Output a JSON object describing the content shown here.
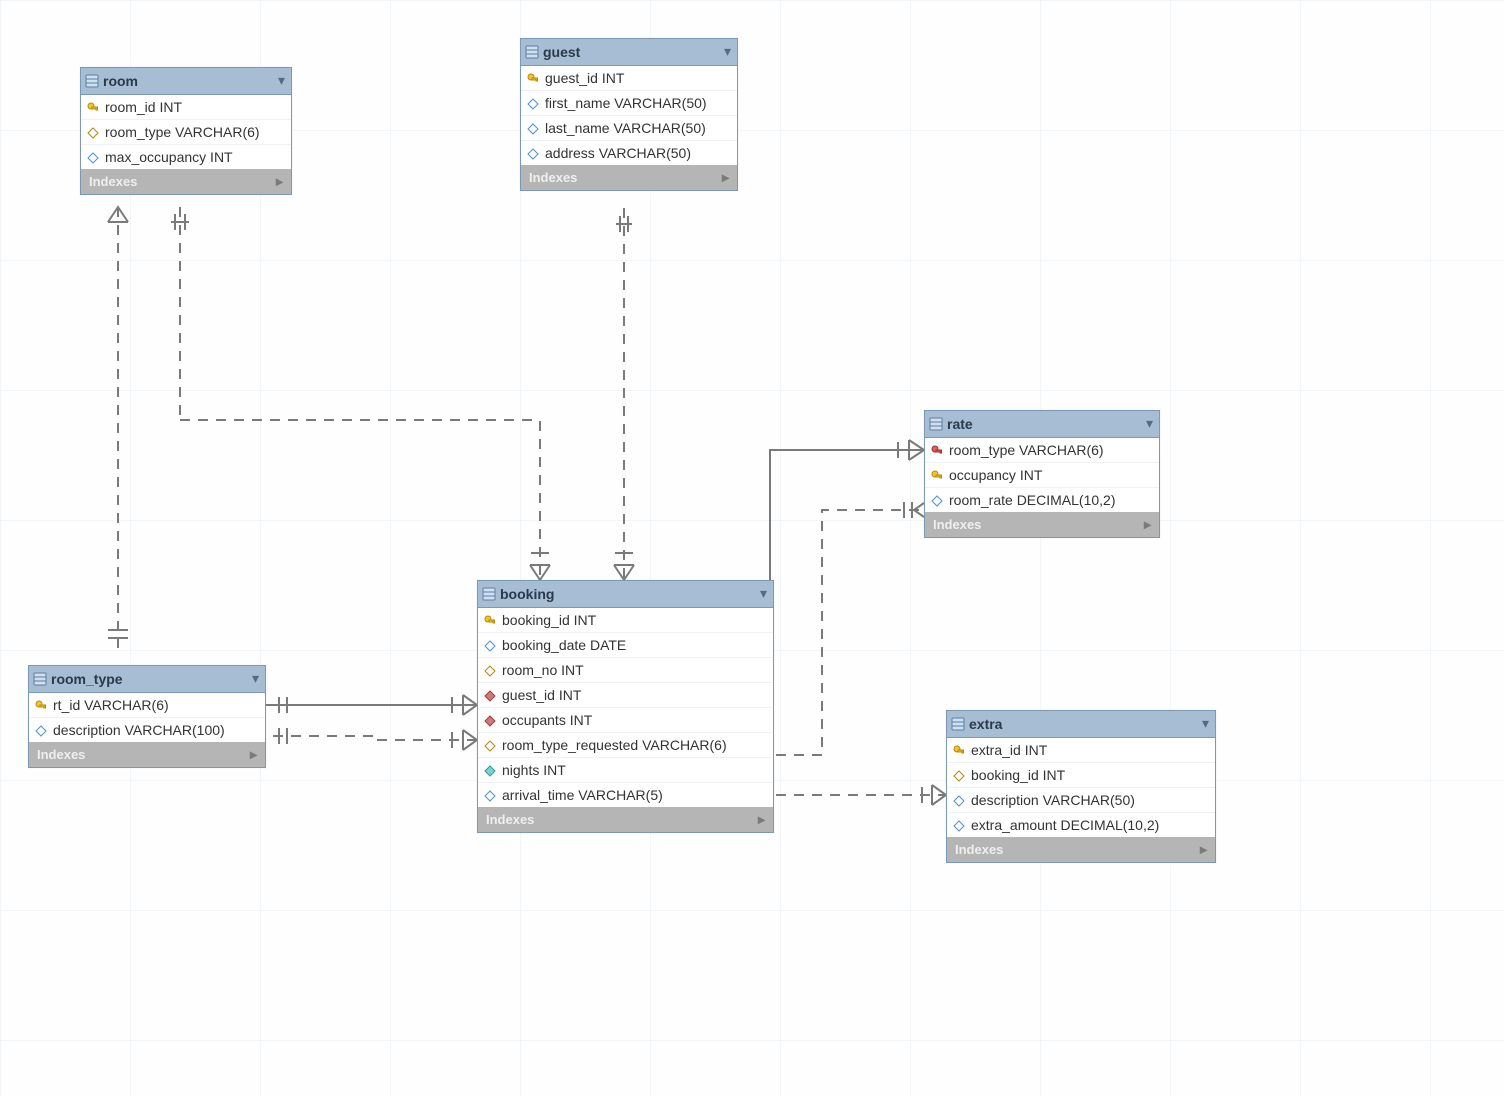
{
  "diagram": {
    "indexes_label": "Indexes",
    "tables": {
      "room": {
        "title": "room",
        "columns": [
          {
            "name": "room_id",
            "type": "INT",
            "icon": "pk"
          },
          {
            "name": "room_type",
            "type": "VARCHAR(6)",
            "icon": "diamond-open"
          },
          {
            "name": "max_occupancy",
            "type": "INT",
            "icon": "diamond-blue"
          }
        ]
      },
      "guest": {
        "title": "guest",
        "columns": [
          {
            "name": "guest_id",
            "type": "INT",
            "icon": "pk"
          },
          {
            "name": "first_name",
            "type": "VARCHAR(50)",
            "icon": "diamond-blue"
          },
          {
            "name": "last_name",
            "type": "VARCHAR(50)",
            "icon": "diamond-blue"
          },
          {
            "name": "address",
            "type": "VARCHAR(50)",
            "icon": "diamond-blue"
          }
        ]
      },
      "rate": {
        "title": "rate",
        "columns": [
          {
            "name": "room_type",
            "type": "VARCHAR(6)",
            "icon": "pk-red"
          },
          {
            "name": "occupancy",
            "type": "INT",
            "icon": "pk"
          },
          {
            "name": "room_rate",
            "type": "DECIMAL(10,2)",
            "icon": "diamond-blue"
          }
        ]
      },
      "booking": {
        "title": "booking",
        "columns": [
          {
            "name": "booking_id",
            "type": "INT",
            "icon": "pk"
          },
          {
            "name": "booking_date",
            "type": "DATE",
            "icon": "diamond-blue"
          },
          {
            "name": "room_no",
            "type": "INT",
            "icon": "diamond-open"
          },
          {
            "name": "guest_id",
            "type": "INT",
            "icon": "diamond-red"
          },
          {
            "name": "occupants",
            "type": "INT",
            "icon": "diamond-red"
          },
          {
            "name": "room_type_requested",
            "type": "VARCHAR(6)",
            "icon": "diamond-open"
          },
          {
            "name": "nights",
            "type": "INT",
            "icon": "diamond-cyan"
          },
          {
            "name": "arrival_time",
            "type": "VARCHAR(5)",
            "icon": "diamond-blue"
          }
        ]
      },
      "room_type": {
        "title": "room_type",
        "columns": [
          {
            "name": "rt_id",
            "type": "VARCHAR(6)",
            "icon": "pk"
          },
          {
            "name": "description",
            "type": "VARCHAR(100)",
            "icon": "diamond-blue"
          }
        ]
      },
      "extra": {
        "title": "extra",
        "columns": [
          {
            "name": "extra_id",
            "type": "INT",
            "icon": "pk"
          },
          {
            "name": "booking_id",
            "type": "INT",
            "icon": "diamond-open"
          },
          {
            "name": "description",
            "type": "VARCHAR(50)",
            "icon": "diamond-blue"
          },
          {
            "name": "extra_amount",
            "type": "DECIMAL(10,2)",
            "icon": "diamond-blue"
          }
        ]
      }
    },
    "relationships": [
      {
        "from": "booking.room_no",
        "to": "room.room_id",
        "style": "dashed"
      },
      {
        "from": "booking.guest_id",
        "to": "guest.guest_id",
        "style": "dashed"
      },
      {
        "from": "booking.room_type_requested",
        "to": "room_type.rt_id",
        "style": "dashed"
      },
      {
        "from": "booking",
        "to": "rate",
        "style": "solid"
      },
      {
        "from": "booking",
        "to": "room_type",
        "style": "solid"
      },
      {
        "from": "extra.booking_id",
        "to": "booking.booking_id",
        "style": "dashed"
      },
      {
        "from": "rate.room_type",
        "to": "room_type.rt_id",
        "style": "dashed"
      },
      {
        "from": "room.room_type",
        "to": "room_type.rt_id",
        "style": "dashed"
      }
    ]
  }
}
